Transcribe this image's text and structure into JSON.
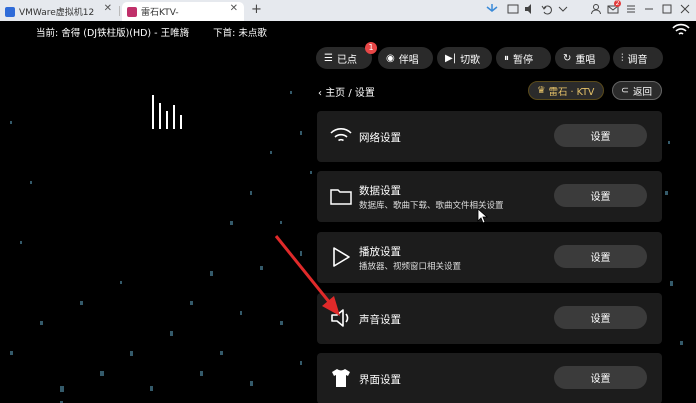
{
  "browser": {
    "tabs": [
      {
        "label": "VMWare虚拟机12",
        "favicon_color": "#2f6bd8",
        "active": false
      },
      {
        "label": "雷石KTV-",
        "favicon_color": "#c0306a",
        "active": true
      }
    ],
    "new_tab": "+",
    "mail_badge": "2"
  },
  "player": {
    "now_label": "当前: 舍得 (DJ铁柱版)(HD) - 王唯旖",
    "next_label": "下首: 未点歌"
  },
  "controls": [
    {
      "label": "已点",
      "icon": "list-icon",
      "badge": "1"
    },
    {
      "label": "伴唱",
      "icon": "mic-icon"
    },
    {
      "label": "切歌",
      "icon": "skip-icon"
    },
    {
      "label": "暂停",
      "icon": "pause-icon"
    },
    {
      "label": "重唱",
      "icon": "replay-icon"
    },
    {
      "label": "调音",
      "icon": "equalizer-icon"
    }
  ],
  "breadcrumb": "主页 / 设置",
  "brand_label": "雷石 · KTV",
  "back_label": "返回",
  "settings": [
    {
      "title": "网络设置",
      "subtitle": "",
      "icon": "wifi-icon",
      "button": "设置"
    },
    {
      "title": "数据设置",
      "subtitle": "数据库、歌曲下载、歌曲文件相关设置",
      "icon": "folder-icon",
      "button": "设置"
    },
    {
      "title": "播放设置",
      "subtitle": "播放器、视频窗口相关设置",
      "icon": "play-icon",
      "button": "设置"
    },
    {
      "title": "声音设置",
      "subtitle": "",
      "icon": "speaker-icon",
      "button": "设置"
    },
    {
      "title": "界面设置",
      "subtitle": "",
      "icon": "shirt-icon",
      "button": "设置"
    }
  ],
  "colors": {
    "accent_gold": "#e7c36a",
    "badge_red": "#e84747",
    "annotation_arrow": "#e02a2a"
  }
}
